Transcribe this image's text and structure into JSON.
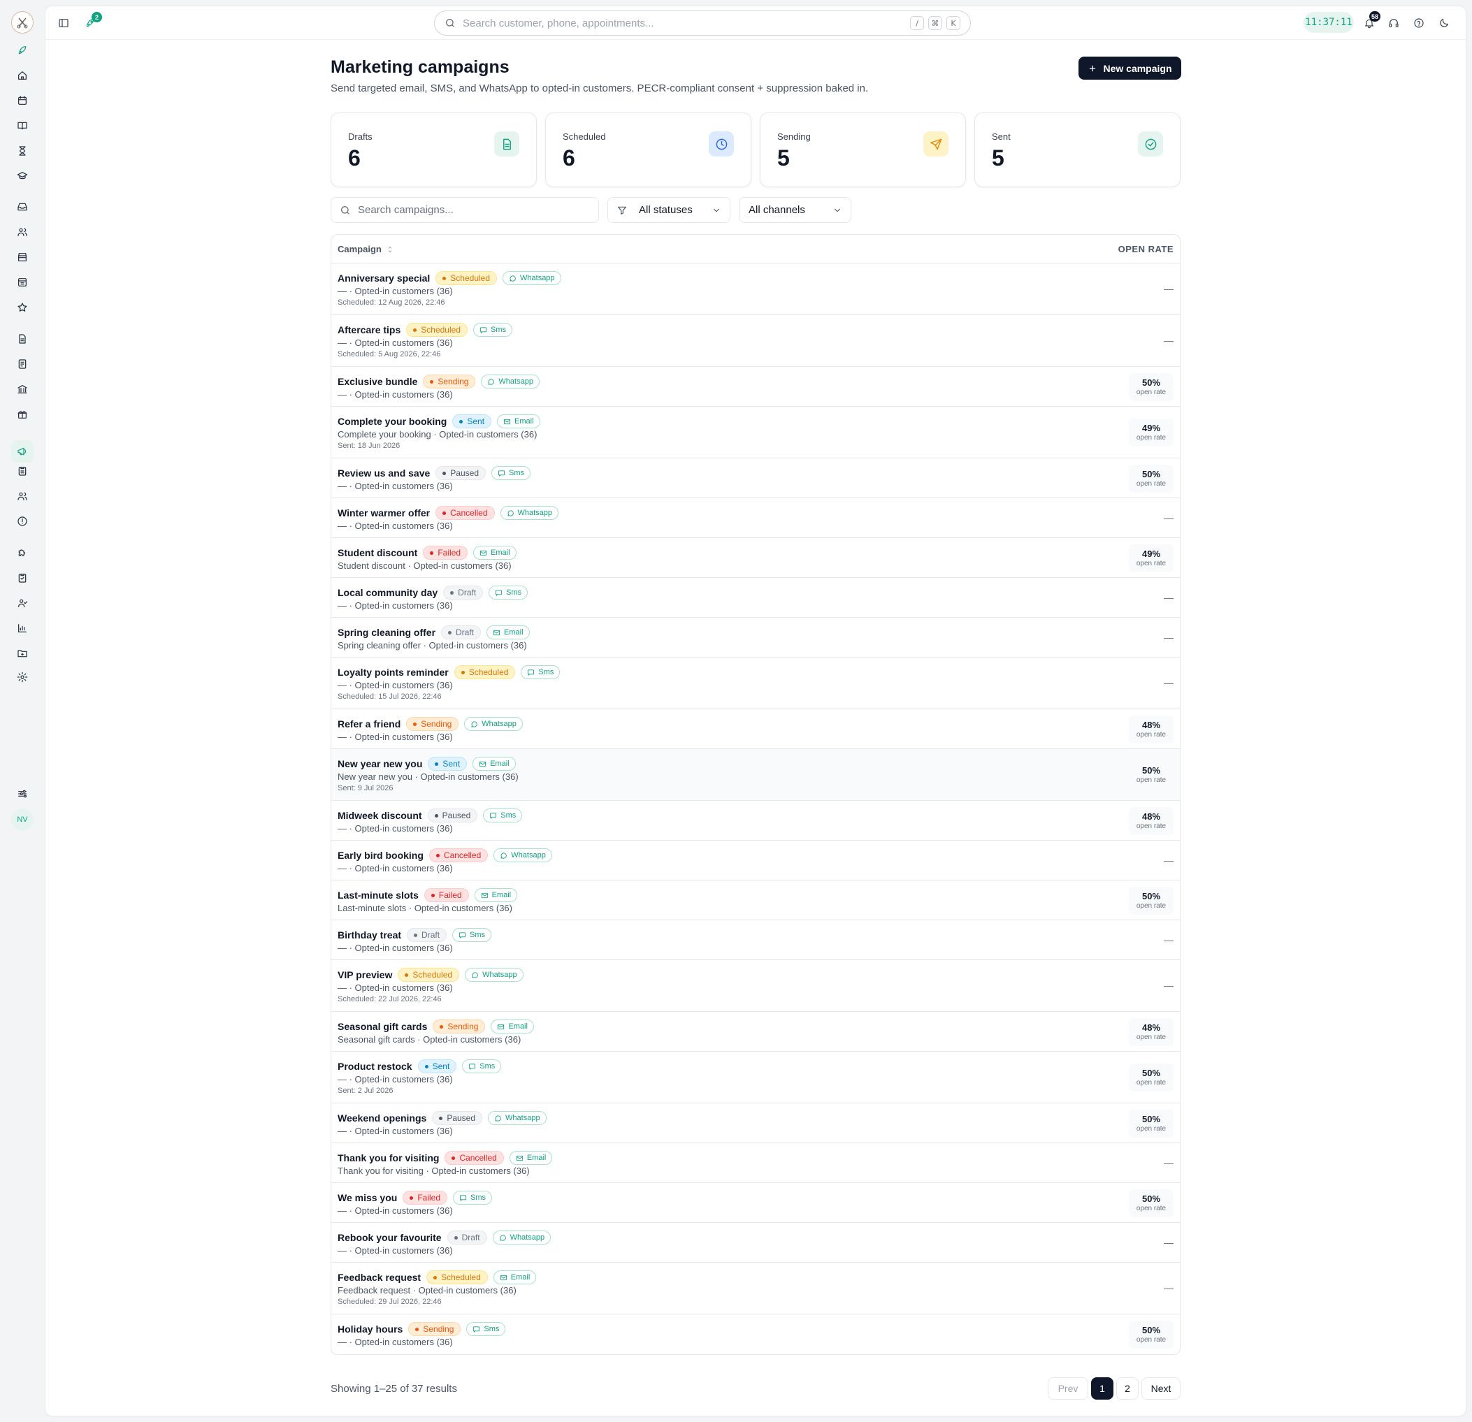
{
  "topbar": {
    "search_placeholder": "Search customer, phone, appointments...",
    "kbd": [
      "/",
      "⌘",
      "K"
    ],
    "launch_badge": "2",
    "clock": "11:37:11",
    "notif_badge": "58"
  },
  "sidebar": {
    "avatar": "NV",
    "accent": "#10a37f",
    "icons": [
      "rocket-icon",
      "home-icon",
      "calendar-icon",
      "book-icon",
      "hourglass-icon",
      "graduation-icon",
      "inbox-icon",
      "users-icon",
      "store-icon",
      "receipt-icon",
      "star-icon",
      "document-icon",
      "invoice-icon",
      "bank-icon",
      "gift-icon",
      "megaphone-icon",
      "clipboard-icon",
      "team-icon",
      "alert-icon",
      "puzzle-icon",
      "checklist-icon",
      "user-check-icon",
      "chart-icon",
      "folder-icon",
      "settings-icon",
      "sliders-icon"
    ]
  },
  "page": {
    "title": "Marketing campaigns",
    "subtitle": "Send targeted email, SMS, and WhatsApp to opted-in customers. PECR-compliant consent + suppression baked in.",
    "new_button": "New campaign"
  },
  "stats": [
    {
      "label": "Drafts",
      "value": "6",
      "icon": "document-icon",
      "color": "#10a37f",
      "bg": "#e6f4ef"
    },
    {
      "label": "Scheduled",
      "value": "6",
      "icon": "clock-icon",
      "color": "#2563eb",
      "bg": "#dbeafe"
    },
    {
      "label": "Sending",
      "value": "5",
      "icon": "send-icon",
      "color": "#ea8a0c",
      "bg": "#fef3c7"
    },
    {
      "label": "Sent",
      "value": "5",
      "icon": "check-circle-icon",
      "color": "#10a37f",
      "bg": "#e6f4ef"
    }
  ],
  "filters": {
    "search_placeholder": "Search campaigns...",
    "status": "All statuses",
    "channel": "All channels"
  },
  "table": {
    "col_campaign": "Campaign",
    "col_open_rate": "OPEN RATE",
    "open_rate_label": "open rate",
    "dash": "—",
    "rows": [
      {
        "name": "Anniversary special",
        "status": "Scheduled",
        "channel": "Whatsapp",
        "audience": "— · Opted-in customers (36)",
        "date": "Scheduled: 12 Aug 2026, 22:46",
        "rate": ""
      },
      {
        "name": "Aftercare tips",
        "status": "Scheduled",
        "channel": "Sms",
        "audience": "— · Opted-in customers (36)",
        "date": "Scheduled: 5 Aug 2026, 22:46",
        "rate": ""
      },
      {
        "name": "Exclusive bundle",
        "status": "Sending",
        "channel": "Whatsapp",
        "audience": "— · Opted-in customers (36)",
        "date": "",
        "rate": "50%"
      },
      {
        "name": "Complete your booking",
        "status": "Sent",
        "channel": "Email",
        "audience": "Complete your booking · Opted-in customers (36)",
        "date": "Sent: 18 Jun 2026",
        "rate": "49%"
      },
      {
        "name": "Review us and save",
        "status": "Paused",
        "channel": "Sms",
        "audience": "— · Opted-in customers (36)",
        "date": "",
        "rate": "50%"
      },
      {
        "name": "Winter warmer offer",
        "status": "Cancelled",
        "channel": "Whatsapp",
        "audience": "— · Opted-in customers (36)",
        "date": "",
        "rate": ""
      },
      {
        "name": "Student discount",
        "status": "Failed",
        "channel": "Email",
        "audience": "Student discount · Opted-in customers (36)",
        "date": "",
        "rate": "49%"
      },
      {
        "name": "Local community day",
        "status": "Draft",
        "channel": "Sms",
        "audience": "— · Opted-in customers (36)",
        "date": "",
        "rate": ""
      },
      {
        "name": "Spring cleaning offer",
        "status": "Draft",
        "channel": "Email",
        "audience": "Spring cleaning offer · Opted-in customers (36)",
        "date": "",
        "rate": ""
      },
      {
        "name": "Loyalty points reminder",
        "status": "Scheduled",
        "channel": "Sms",
        "audience": "— · Opted-in customers (36)",
        "date": "Scheduled: 15 Jul 2026, 22:46",
        "rate": ""
      },
      {
        "name": "Refer a friend",
        "status": "Sending",
        "channel": "Whatsapp",
        "audience": "— · Opted-in customers (36)",
        "date": "",
        "rate": "48%"
      },
      {
        "name": "New year new you",
        "status": "Sent",
        "channel": "Email",
        "audience": "New year new you · Opted-in customers (36)",
        "date": "Sent: 9 Jul 2026",
        "rate": "50%",
        "highlight": true
      },
      {
        "name": "Midweek discount",
        "status": "Paused",
        "channel": "Sms",
        "audience": "— · Opted-in customers (36)",
        "date": "",
        "rate": "48%"
      },
      {
        "name": "Early bird booking",
        "status": "Cancelled",
        "channel": "Whatsapp",
        "audience": "— · Opted-in customers (36)",
        "date": "",
        "rate": ""
      },
      {
        "name": "Last-minute slots",
        "status": "Failed",
        "channel": "Email",
        "audience": "Last-minute slots · Opted-in customers (36)",
        "date": "",
        "rate": "50%"
      },
      {
        "name": "Birthday treat",
        "status": "Draft",
        "channel": "Sms",
        "audience": "— · Opted-in customers (36)",
        "date": "",
        "rate": ""
      },
      {
        "name": "VIP preview",
        "status": "Scheduled",
        "channel": "Whatsapp",
        "audience": "— · Opted-in customers (36)",
        "date": "Scheduled: 22 Jul 2026, 22:46",
        "rate": ""
      },
      {
        "name": "Seasonal gift cards",
        "status": "Sending",
        "channel": "Email",
        "audience": "Seasonal gift cards · Opted-in customers (36)",
        "date": "",
        "rate": "48%"
      },
      {
        "name": "Product restock",
        "status": "Sent",
        "channel": "Sms",
        "audience": "— · Opted-in customers (36)",
        "date": "Sent: 2 Jul 2026",
        "rate": "50%"
      },
      {
        "name": "Weekend openings",
        "status": "Paused",
        "channel": "Whatsapp",
        "audience": "— · Opted-in customers (36)",
        "date": "",
        "rate": "50%"
      },
      {
        "name": "Thank you for visiting",
        "status": "Cancelled",
        "channel": "Email",
        "audience": "Thank you for visiting · Opted-in customers (36)",
        "date": "",
        "rate": ""
      },
      {
        "name": "We miss you",
        "status": "Failed",
        "channel": "Sms",
        "audience": "— · Opted-in customers (36)",
        "date": "",
        "rate": "50%"
      },
      {
        "name": "Rebook your favourite",
        "status": "Draft",
        "channel": "Whatsapp",
        "audience": "— · Opted-in customers (36)",
        "date": "",
        "rate": ""
      },
      {
        "name": "Feedback request",
        "status": "Scheduled",
        "channel": "Email",
        "audience": "Feedback request · Opted-in customers (36)",
        "date": "Scheduled: 29 Jul 2026, 22:46",
        "rate": ""
      },
      {
        "name": "Holiday hours",
        "status": "Sending",
        "channel": "Sms",
        "audience": "— · Opted-in customers (36)",
        "date": "",
        "rate": "50%"
      }
    ]
  },
  "footer": {
    "info": "Showing 1–25 of 37 results",
    "prev": "Prev",
    "pages": [
      "1",
      "2"
    ],
    "current": "1",
    "next": "Next"
  }
}
